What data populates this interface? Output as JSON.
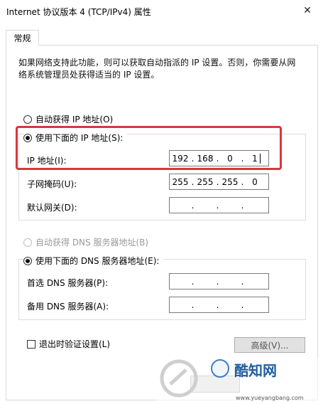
{
  "window": {
    "title": "Internet 协议版本 4 (TCP/IPv4) 属性",
    "close_glyph": "✕"
  },
  "tab": {
    "label": "常规"
  },
  "description": "如果网络支持此功能，则可以获取自动指派的 IP 设置。否则，你需要从网络系统管理员处获得适当的 IP 设置。",
  "ip_section": {
    "auto_label": "自动获得 IP 地址(O)",
    "manual_label": "使用下面的 IP 地址(S):",
    "auto_checked": false,
    "manual_checked": true,
    "fields": [
      {
        "label": "IP 地址(I):",
        "octets": [
          "192",
          "168",
          "0",
          "1"
        ]
      },
      {
        "label": "子网掩码(U):",
        "octets": [
          "255",
          "255",
          "255",
          "0"
        ]
      },
      {
        "label": "默认网关(D):",
        "octets": [
          "",
          "",
          "",
          ""
        ]
      }
    ]
  },
  "dns_section": {
    "auto_label": "自动获得 DNS 服务器地址(B)",
    "manual_label": "使用下面的 DNS 服务器地址(E):",
    "auto_checked": false,
    "auto_disabled": true,
    "manual_checked": true,
    "fields": [
      {
        "label": "首选 DNS 服务器(P):",
        "octets": [
          "",
          "",
          "",
          ""
        ]
      },
      {
        "label": "备用 DNS 服务器(A):",
        "octets": [
          "",
          "",
          "",
          ""
        ]
      }
    ]
  },
  "validate": {
    "label": "退出时验证设置(L)",
    "checked": false
  },
  "advanced_button": {
    "label": "高级(V)..."
  },
  "watermark": {
    "brand": "酷知网",
    "site": "www.yueyangbang.com"
  },
  "colors": {
    "highlight": "#d8373d",
    "border": "#dcdcdc",
    "button_bg": "#e1e1e1"
  }
}
